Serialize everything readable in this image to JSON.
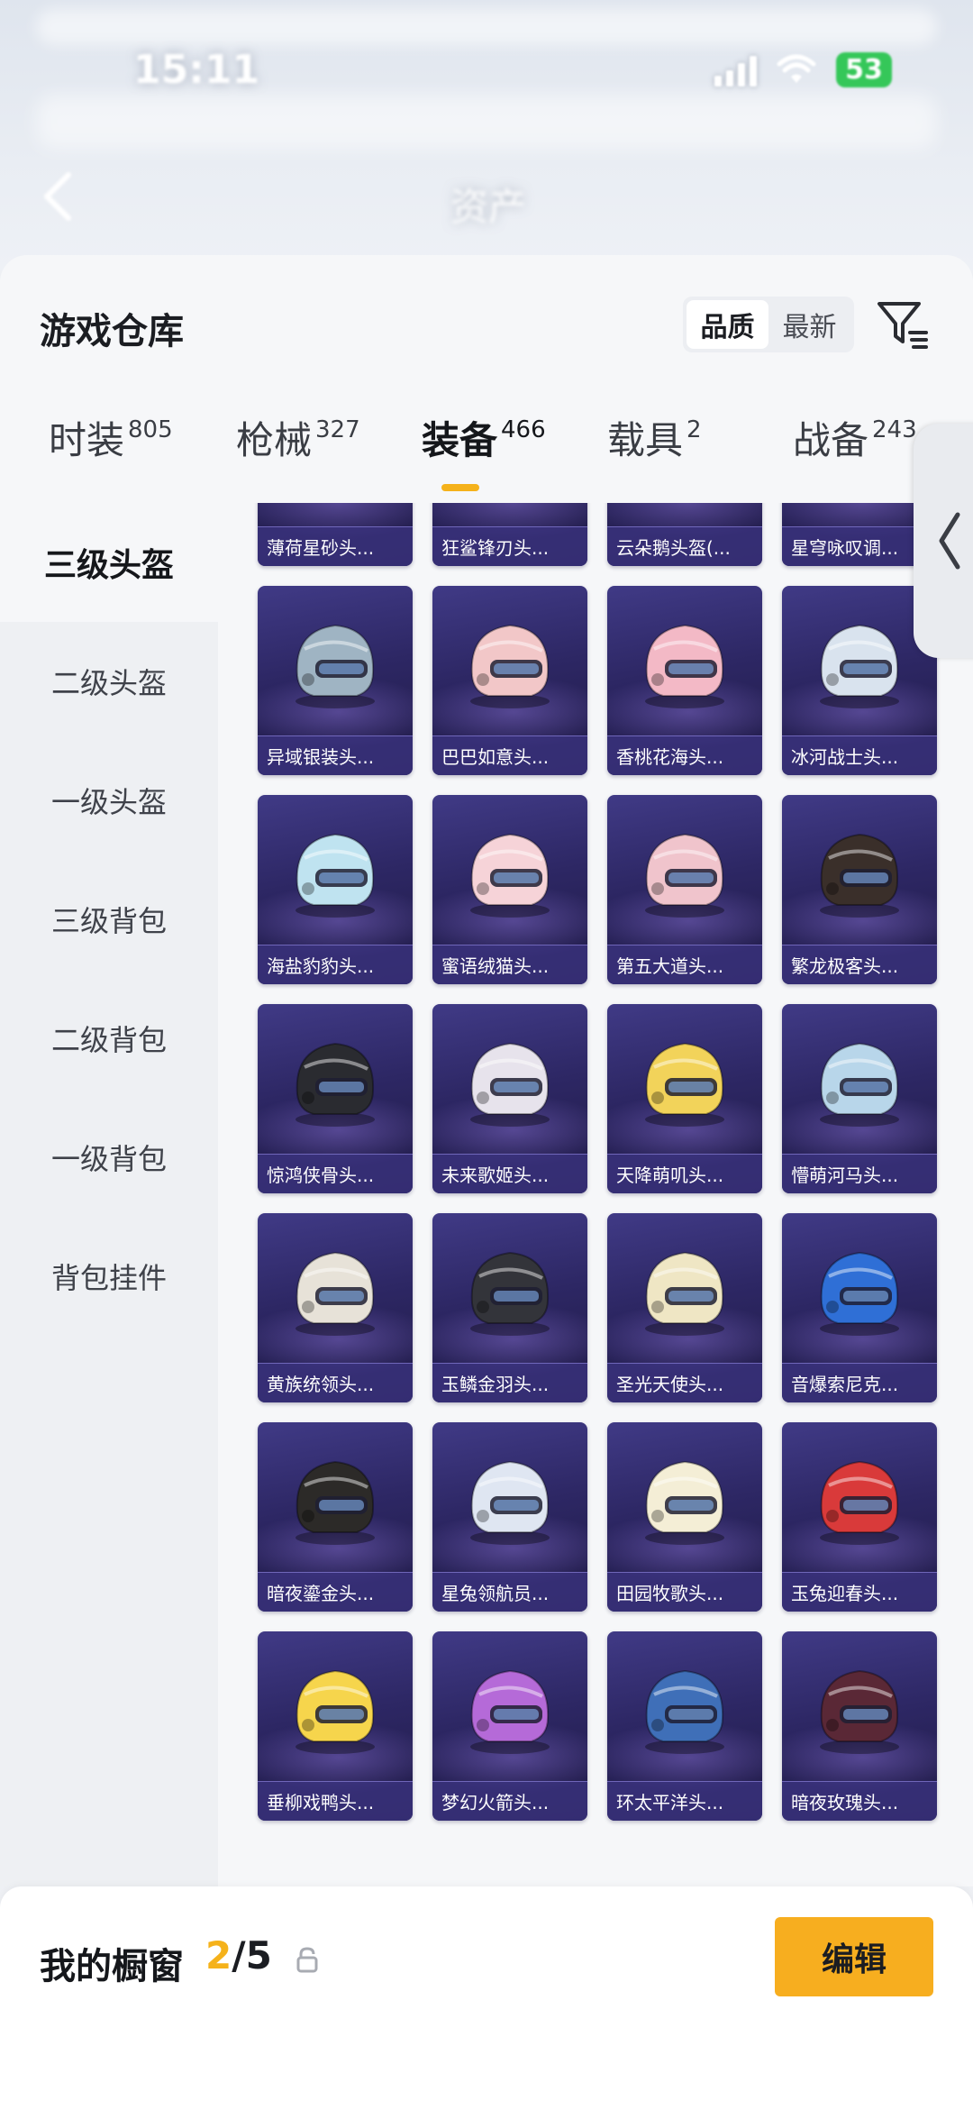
{
  "status_bar": {
    "time": "15:11",
    "battery": "53"
  },
  "header": {
    "title": "资产"
  },
  "warehouse": {
    "title": "游戏仓库",
    "sort_options": [
      "品质",
      "最新"
    ],
    "sort_selected": "品质"
  },
  "tabs": [
    {
      "label": "时装",
      "count": "805"
    },
    {
      "label": "枪械",
      "count": "327"
    },
    {
      "label": "装备",
      "count": "466",
      "active": true
    },
    {
      "label": "载具",
      "count": "2"
    },
    {
      "label": "战备",
      "count": "243"
    }
  ],
  "categories": [
    "三级头盔",
    "二级头盔",
    "一级头盔",
    "三级背包",
    "二级背包",
    "一级背包",
    "背包挂件"
  ],
  "category_selected": "三级头盔",
  "items": [
    {
      "name": "薄荷星砂头...",
      "color": "#cfe9e0"
    },
    {
      "name": "狂鲨锋刃头...",
      "color": "#2b2e36"
    },
    {
      "name": "云朵鹅头盔(...",
      "color": "#f3e6b8"
    },
    {
      "name": "星穹咏叹调...",
      "color": "#7a5e3e"
    },
    {
      "name": "异域银装头...",
      "color": "#9fb4c3"
    },
    {
      "name": "巴巴如意头...",
      "color": "#f2c7c8"
    },
    {
      "name": "香桃花海头...",
      "color": "#f3b9c6"
    },
    {
      "name": "冰河战士头...",
      "color": "#d9e3ee"
    },
    {
      "name": "海盐豹豹头...",
      "color": "#bfe3f0"
    },
    {
      "name": "蜜语绒猫头...",
      "color": "#f6d3d8"
    },
    {
      "name": "第五大道头...",
      "color": "#f0c4cc"
    },
    {
      "name": "繁龙极客头...",
      "color": "#3a2f2a"
    },
    {
      "name": "惊鸿侠骨头...",
      "color": "#2a2b30"
    },
    {
      "name": "未来歌姬头...",
      "color": "#e7e3ec"
    },
    {
      "name": "天降萌叽头...",
      "color": "#f2d35a"
    },
    {
      "name": "懵萌河马头...",
      "color": "#b8d6ea"
    },
    {
      "name": "黄族统领头...",
      "color": "#e7e2d8"
    },
    {
      "name": "玉鳞金羽头...",
      "color": "#33343a"
    },
    {
      "name": "圣光天使头...",
      "color": "#efe6c4"
    },
    {
      "name": "音爆索尼克...",
      "color": "#2f6fd6"
    },
    {
      "name": "暗夜鎏金头...",
      "color": "#2c2a28"
    },
    {
      "name": "星兔领航员...",
      "color": "#dfe6f2"
    },
    {
      "name": "田园牧歌头...",
      "color": "#f4eed6"
    },
    {
      "name": "玉兔迎春头...",
      "color": "#d93a3a"
    },
    {
      "name": "垂柳戏鸭头...",
      "color": "#f6d54c"
    },
    {
      "name": "梦幻火箭头...",
      "color": "#b56ad8"
    },
    {
      "name": "环太平洋头...",
      "color": "#3f6fb8"
    },
    {
      "name": "暗夜玫瑰头...",
      "color": "#5a2836"
    }
  ],
  "showcase": {
    "label": "我的橱窗",
    "current": "2",
    "total": "/5"
  },
  "edit_button": "编辑",
  "colors": {
    "accent": "#f5b21b",
    "card_bg": "#2d2764"
  }
}
